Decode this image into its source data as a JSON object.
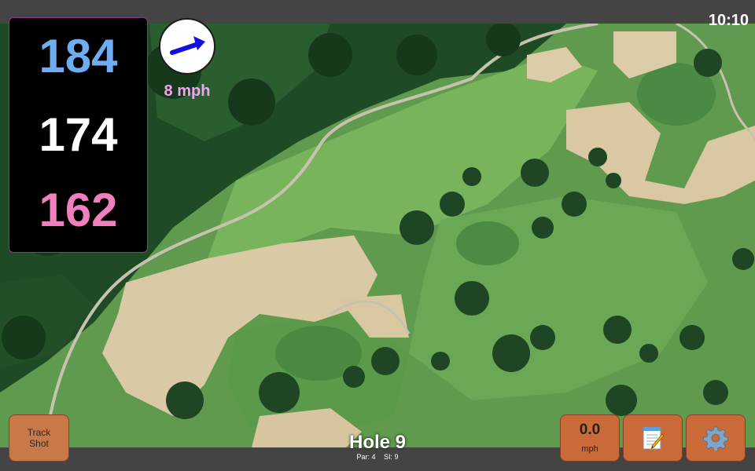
{
  "status_bar": {
    "time": "10:10"
  },
  "yardages": {
    "back": "184",
    "middle": "174",
    "front": "162"
  },
  "wind": {
    "speed_label": "8 mph",
    "direction_icon": "wind-arrow-icon"
  },
  "hole": {
    "title": "Hole 9",
    "par_label": "Par: 4",
    "si_label": "SI: 9"
  },
  "buttons": {
    "track_shot_line1": "Track",
    "track_shot_line2": "Shot",
    "speed_value": "0.0",
    "speed_unit": "mph",
    "notes_icon": "notepad-icon",
    "settings_icon": "gear-icon"
  },
  "colors": {
    "back_yardage": "#6eaef0",
    "middle_yardage": "#ffffff",
    "front_yardage": "#f27fbd",
    "wind_label": "#f2a3f2",
    "button_orange": "#c96a38"
  }
}
